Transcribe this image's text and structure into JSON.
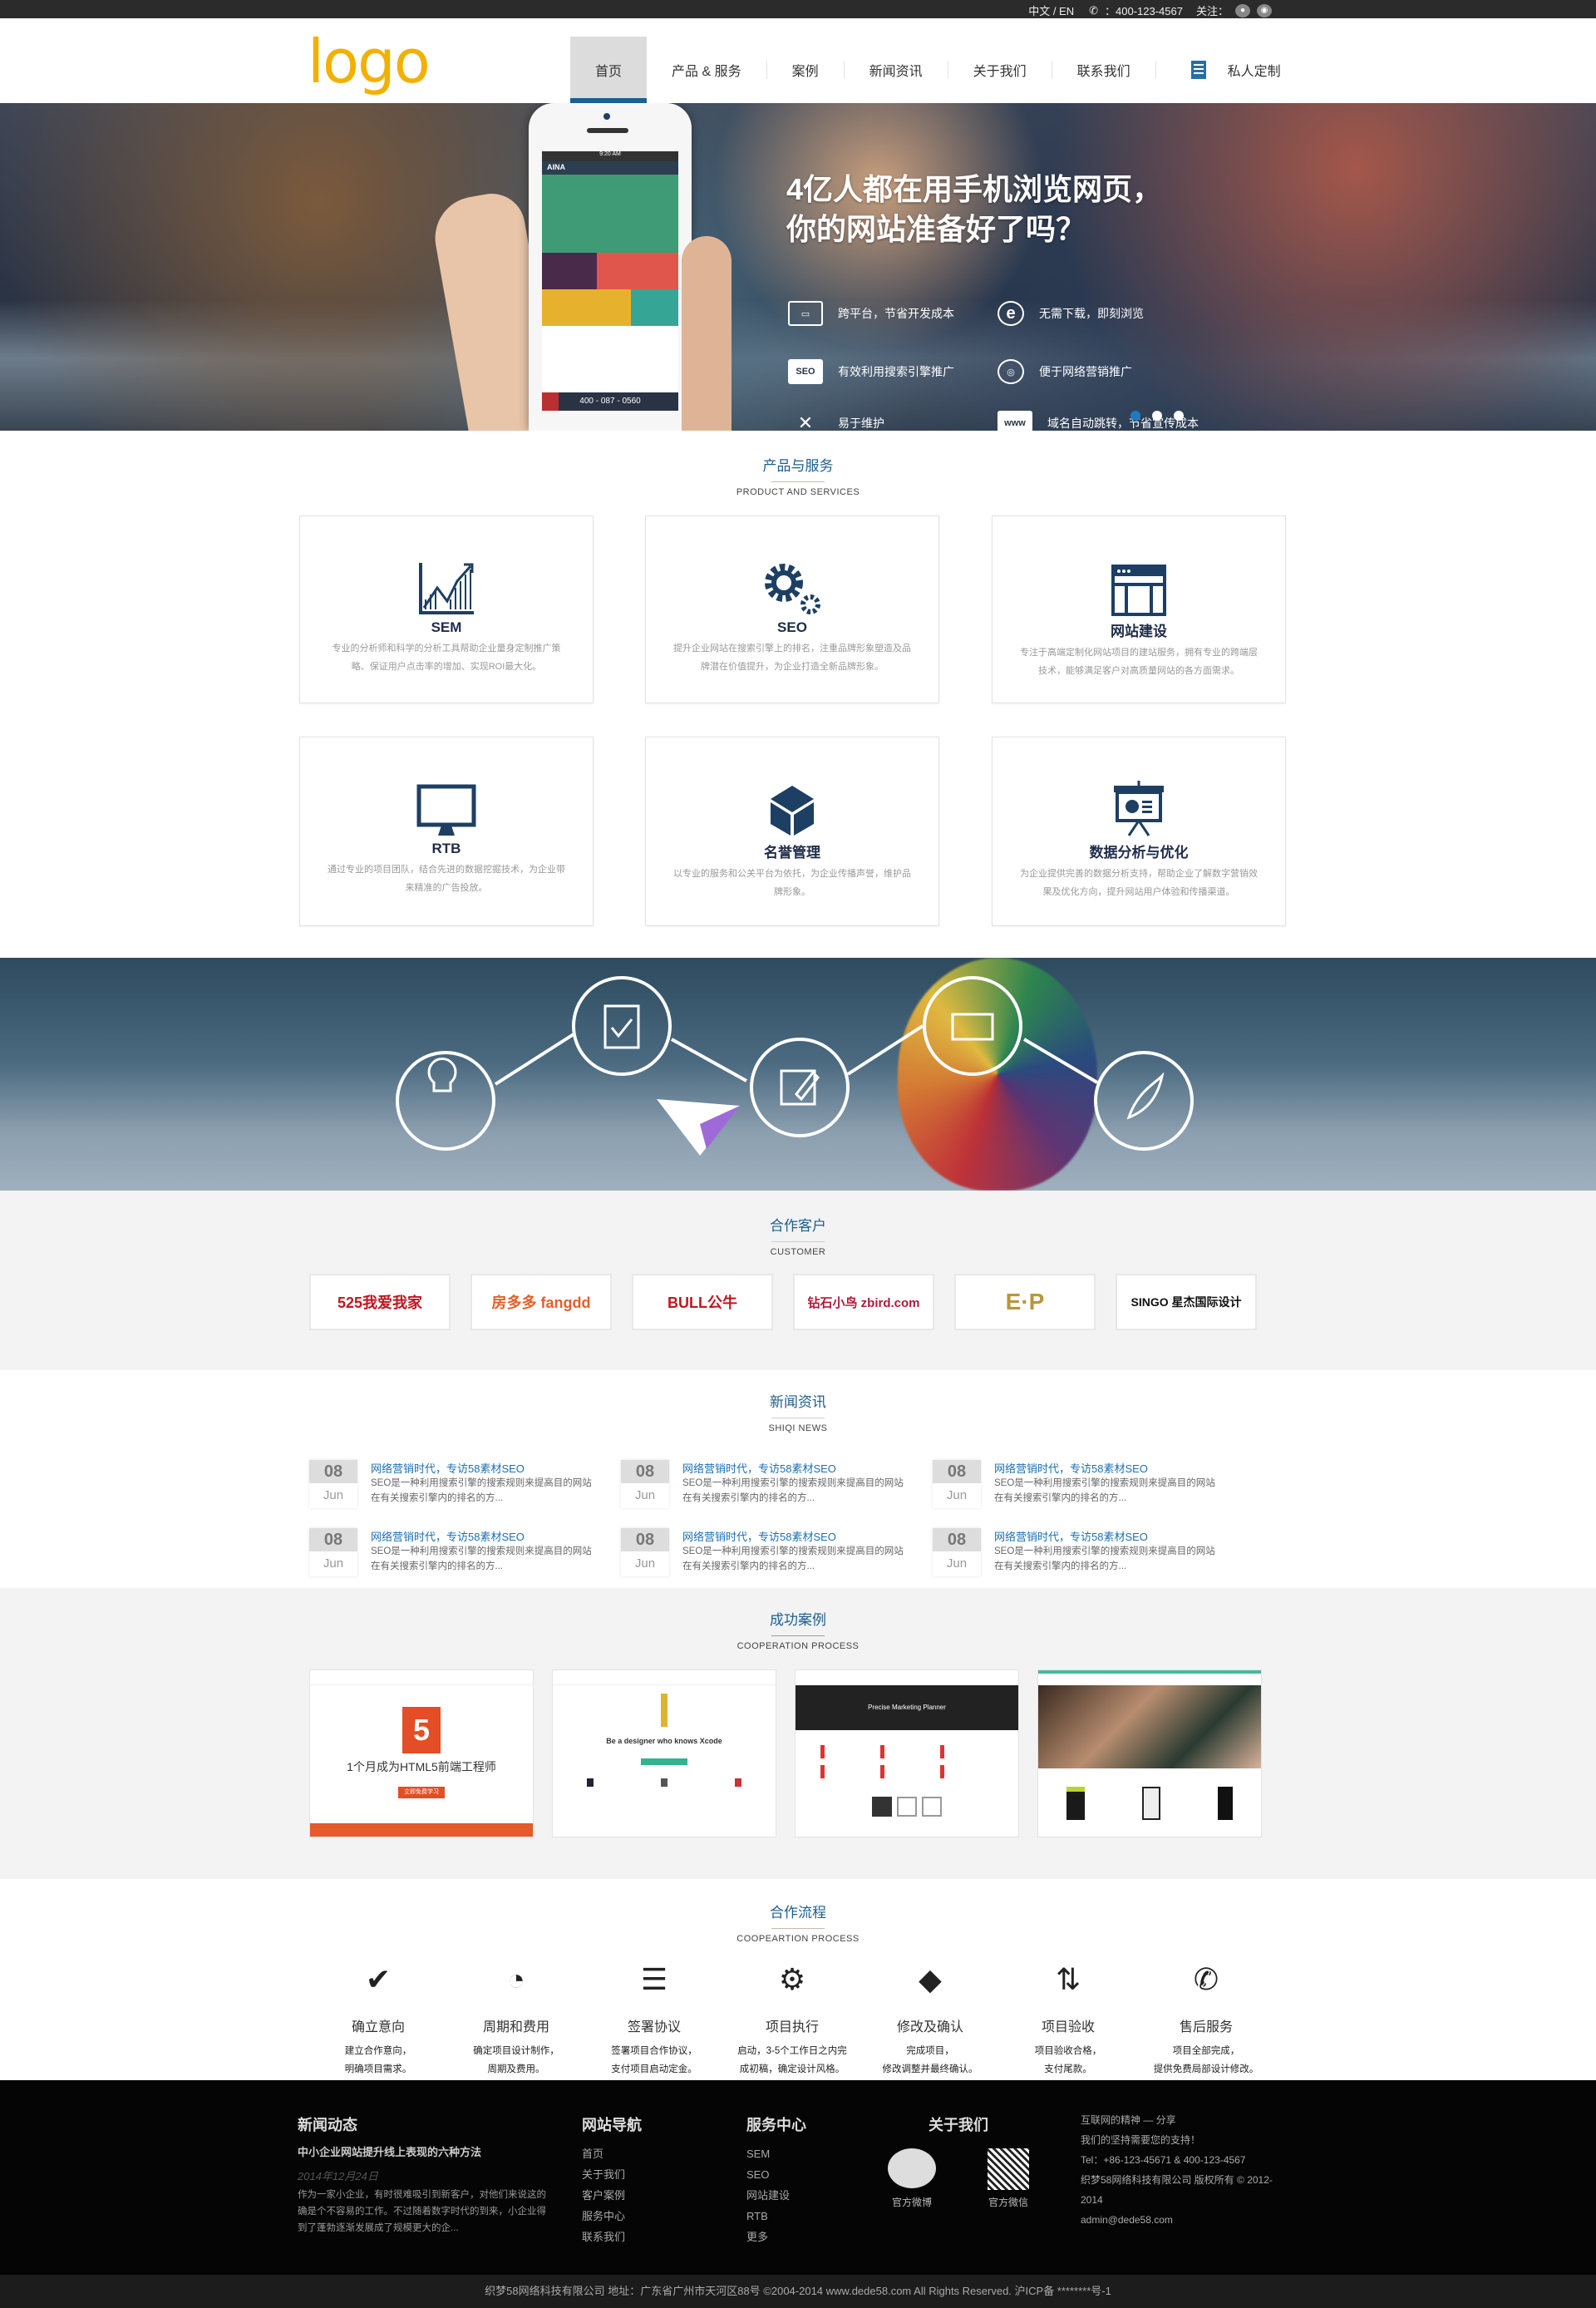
{
  "topbar": {
    "lang": "中文 / EN",
    "phone": "：400-123-4567",
    "follow": "关注："
  },
  "header": {
    "logo": "logo",
    "nav": [
      "首页",
      "产品 & 服务",
      "案例",
      "新闻资讯",
      "关于我们",
      "联系我们"
    ],
    "active_index": 0,
    "custom": "私人定制"
  },
  "hero": {
    "title_line1": "4亿人都在用手机浏览网页，",
    "title_line2": "你的网站准备好了吗？",
    "features": [
      {
        "icon": "devices-icon",
        "glyph": "▭",
        "text": "跨平台，节省开发成本"
      },
      {
        "icon": "ie-browser-icon",
        "glyph": "e",
        "text": "无需下载，即刻浏览"
      },
      {
        "icon": "seo-icon",
        "glyph": "SEO",
        "text": "有效利用搜索引擎推广"
      },
      {
        "icon": "compass-icon",
        "glyph": "◎",
        "text": "便于网络营销推广"
      },
      {
        "icon": "tools-icon",
        "glyph": "✕",
        "text": "易于维护"
      },
      {
        "icon": "www-icon",
        "glyph": "www",
        "text": "域名自动跳转，节省宣传成本"
      }
    ],
    "phone_time": "9:20 AM",
    "phone_brand": "AINA",
    "phone_number": "400 - 087 - 0560",
    "slides": 3,
    "active_slide": 0
  },
  "products": {
    "title": "产品与服务",
    "subtitle": "PRODUCT AND   SERVICES",
    "items": [
      {
        "name": "SEM",
        "icon": "chart-growth-icon",
        "desc": "专业的分析师和科学的分析工具帮助企业量身定制推广策略、保证用户点击率的增加、实现ROI最大化。"
      },
      {
        "name": "SEO",
        "icon": "gears-icon",
        "desc": "提升企业网站在搜索引擎上的排名，注重品牌形象塑造及品牌潜在价值提升，为企业打造全新品牌形象。"
      },
      {
        "name": "网站建设",
        "icon": "browser-window-icon",
        "desc": "专注于高端定制化网站项目的建站服务，拥有专业的跨端层技术，能够满足客户对高质量网站的各方面需求。"
      },
      {
        "name": "RTB",
        "icon": "monitor-icon",
        "desc": "通过专业的项目团队，结合先进的数据挖掘技术，为企业带来精准的广告投放。"
      },
      {
        "name": "名誉管理",
        "icon": "cube-icon",
        "desc": "以专业的服务和公关平台为依托，为企业传播声誉，维护品牌形象。"
      },
      {
        "name": "数据分析与优化",
        "icon": "presentation-icon",
        "desc": "为企业提供完善的数据分析支持，帮助企业了解数字营销效果及优化方向，提升网站用户体验和传播渠道。"
      }
    ]
  },
  "banner2": {
    "nodes": [
      "lightbulb-head-icon",
      "clipboard-check-icon",
      "edit-icon",
      "keyboard-icon",
      "leaf-icon"
    ]
  },
  "clients": {
    "title": "合作客户",
    "subtitle": "CUSTOMER",
    "logos": [
      {
        "name": "525我爱我家",
        "color": "#c0161f"
      },
      {
        "name": "房多多 fangdd",
        "color": "#e0612a"
      },
      {
        "name": "BULL公牛",
        "color": "#c0161f"
      },
      {
        "name": "钻石小鸟 zbird.com",
        "color": "#b0193a"
      },
      {
        "name": "E·P",
        "color": "#b8963e"
      },
      {
        "name": "SINGO 星杰国际设计",
        "color": "#111111"
      }
    ]
  },
  "news": {
    "title": "新闻资讯",
    "subtitle": "SHIQI NEWS",
    "items": [
      {
        "day": "08",
        "month": "Jun",
        "title": "网络营销时代，专访58素材SEO",
        "summary": "SEO是一种利用搜索引擎的搜索规则来提高目的网站在有关搜索引擎内的排名的方..."
      },
      {
        "day": "08",
        "month": "Jun",
        "title": "网络营销时代，专访58素材SEO",
        "summary": "SEO是一种利用搜索引擎的搜索规则来提高目的网站在有关搜索引擎内的排名的方..."
      },
      {
        "day": "08",
        "month": "Jun",
        "title": "网络营销时代，专访58素材SEO",
        "summary": "SEO是一种利用搜索引擎的搜索规则来提高目的网站在有关搜索引擎内的排名的方..."
      },
      {
        "day": "08",
        "month": "Jun",
        "title": "网络营销时代，专访58素材SEO",
        "summary": "SEO是一种利用搜索引擎的搜索规则来提高目的网站在有关搜索引擎内的排名的方..."
      },
      {
        "day": "08",
        "month": "Jun",
        "title": "网络营销时代，专访58素材SEO",
        "summary": "SEO是一种利用搜索引擎的搜索规则来提高目的网站在有关搜索引擎内的排名的方..."
      },
      {
        "day": "08",
        "month": "Jun",
        "title": "网络营销时代，专访58素材SEO",
        "summary": "SEO是一种利用搜索引擎的搜索规则来提高目的网站在有关搜索引擎内的排名的方..."
      }
    ]
  },
  "cases": {
    "title": "成功案例",
    "subtitle": "COOPERATION PROCESS",
    "items": [
      {
        "caption": "1个月成为HTML5前端工程师",
        "button": "立即免费学习"
      },
      {
        "caption": "Be a designer who knows Xcode",
        "button": ""
      },
      {
        "caption": "Precise Marketing Planner",
        "button": ""
      },
      {
        "caption": "",
        "button": ""
      }
    ]
  },
  "process": {
    "title": "合作流程",
    "subtitle": "COOPEARTION PROCESS",
    "steps": [
      {
        "icon": "check-tray-icon",
        "glyph": "✔",
        "name": "确立意向",
        "l1": "建立合作意向，",
        "l2": "明确项目需求。"
      },
      {
        "icon": "gauge-icon",
        "glyph": "◔",
        "name": "周期和费用",
        "l1": "确定项目设计制作，",
        "l2": "周期及费用。"
      },
      {
        "icon": "document-list-icon",
        "glyph": "☰",
        "name": "签署协议",
        "l1": "签署项目合作协议，",
        "l2": "支付项目启动定金。"
      },
      {
        "icon": "gear-icon",
        "glyph": "⚙",
        "name": "项目执行",
        "l1": "启动，3-5个工作日之内完",
        "l2": "成初稿，确定设计风格。"
      },
      {
        "icon": "tag-icon",
        "glyph": "◆",
        "name": "修改及确认",
        "l1": "完成项目，",
        "l2": "修改调整并最终确认。"
      },
      {
        "icon": "retweet-icon",
        "glyph": "⇅",
        "name": "项目验收",
        "l1": "项目验收合格，",
        "l2": "支付尾款。"
      },
      {
        "icon": "phone-icon",
        "glyph": "✆",
        "name": "售后服务",
        "l1": "项目全部完成，",
        "l2": "提供免费局部设计修改。"
      }
    ]
  },
  "footer": {
    "news": {
      "heading": "新闻动态",
      "title": "中小企业网站提升线上表现的六种方法",
      "date": "2014年12月24日",
      "body": "作为一家小企业，有时很难吸引到新客户，对他们来说这的确是个不容易的工作。不过随着数字时代的到来，小企业得到了蓬勃逐渐发展成了规模更大的企..."
    },
    "nav": {
      "heading": "网站导航",
      "links": [
        "首页",
        "关于我们",
        "客户案例",
        "服务中心",
        "联系我们"
      ]
    },
    "service": {
      "heading": "服务中心",
      "links": [
        "SEM",
        "SEO",
        "网站建设",
        "RTB",
        "更多"
      ]
    },
    "about": {
      "heading": "关于我们",
      "weibo": "官方微博",
      "wechat": "官方微信"
    },
    "contact": [
      "互联网的精神 — 分享",
      "我们的坚持需要您的支持！",
      "Tel：+86-123-45671 & 400-123-4567",
      "织梦58网络科技有限公司 版权所有 © 2012-2014",
      "admin@dede58.com"
    ],
    "copyright": "织梦58网络科技有限公司 地址：广东省广州市天河区88号 ©2004-2014 www.dede58.com All Rights Reserved. 沪ICP备 ********号-1"
  }
}
